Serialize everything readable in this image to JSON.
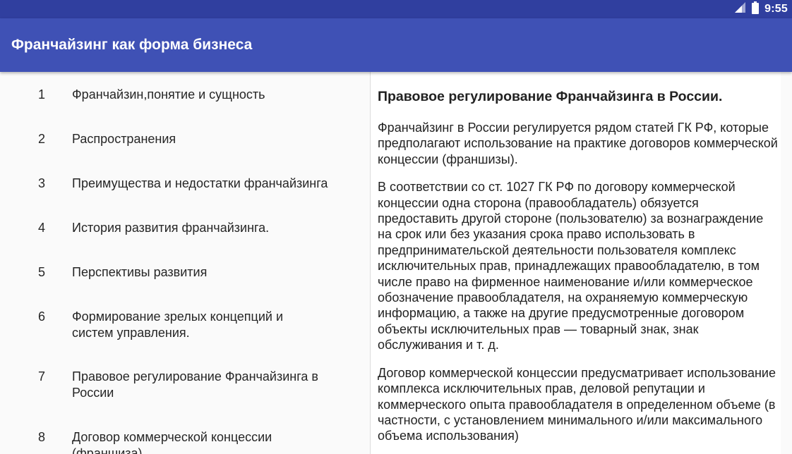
{
  "status_bar": {
    "time": "9:55",
    "icons": [
      "signal-icon",
      "battery-icon"
    ]
  },
  "app_bar": {
    "title": "Франчайзинг как форма бизнеса"
  },
  "toc": {
    "items": [
      {
        "num": "1",
        "label": "Франчайзин,понятие и сущность"
      },
      {
        "num": "2",
        "label": "Распространения"
      },
      {
        "num": "3",
        "label": "Преимущества и недостатки франчайзинга"
      },
      {
        "num": "4",
        "label": "История развития франчайзинга."
      },
      {
        "num": "5",
        "label": "Перспективы развития"
      },
      {
        "num": "6",
        "label": "Формирование зрелых концепций и систем управления."
      },
      {
        "num": "7",
        "label": "Правовое регулирование Франчайзинга в России"
      },
      {
        "num": "8",
        "label": "Договор коммерческой концессии (франшиза)"
      }
    ]
  },
  "article": {
    "title": "Правовое регулирование Франчайзинга в России.",
    "paragraphs": [
      "Франчайзинг в России регулируется рядом статей ГК РФ, которые предполагают использование на практике договоров коммерческой концессии (франшизы).",
      "В соответствии со ст. 1027 ГК РФ по договору коммерческой концессии одна сторона (правообладатель) обязуется предоставить другой стороне (пользователю) за вознаграждение на срок или без указания срока право использовать в предпринимательской деятельности пользователя комплекс исключительных прав, принадлежащих правообладателю, в том числе право на фирменное наименование и/или коммерческое обозначение правообладателя, на охраняемую коммерческую информацию, а также на другие предусмотренные договором объекты исключительных прав — товарный знак, знак обслуживания и т. д.",
      "Договор коммерческой концессии предусматривает использование комплекса исключительных прав, деловой репутации и коммерческого опыта правообладателя в определенном объеме (в частности, с установлением минимального и/или максимального объема использования)"
    ]
  },
  "colors": {
    "status_bar": "#303f9f",
    "app_bar": "#3f51b5",
    "left_bg": "#fafafa",
    "right_bg": "#ffffff"
  }
}
